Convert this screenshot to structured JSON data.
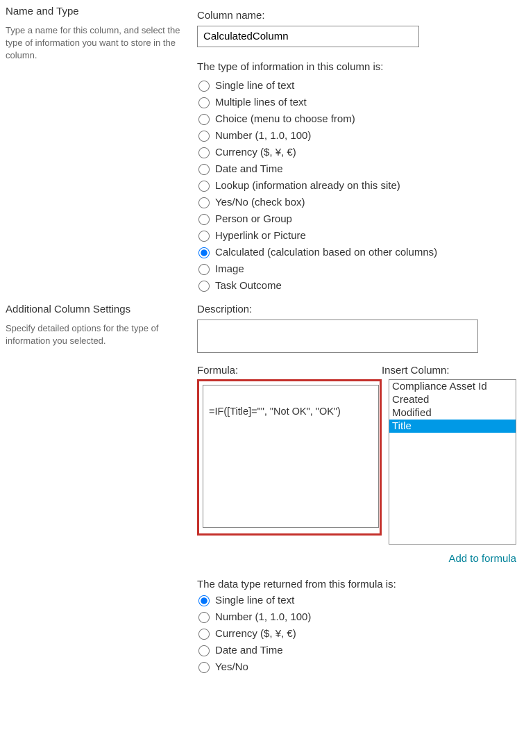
{
  "section1": {
    "title": "Name and Type",
    "desc": "Type a name for this column, and select the type of information you want to store in the column."
  },
  "columnName": {
    "label": "Column name:",
    "value": "CalculatedColumn"
  },
  "typeInfo": {
    "label": "The type of information in this column is:",
    "options": [
      {
        "label": "Single line of text",
        "checked": false
      },
      {
        "label": "Multiple lines of text",
        "checked": false
      },
      {
        "label": "Choice (menu to choose from)",
        "checked": false
      },
      {
        "label": "Number (1, 1.0, 100)",
        "checked": false
      },
      {
        "label": "Currency ($, ¥, €)",
        "checked": false
      },
      {
        "label": "Date and Time",
        "checked": false
      },
      {
        "label": "Lookup (information already on this site)",
        "checked": false
      },
      {
        "label": "Yes/No (check box)",
        "checked": false
      },
      {
        "label": "Person or Group",
        "checked": false
      },
      {
        "label": "Hyperlink or Picture",
        "checked": false
      },
      {
        "label": "Calculated (calculation based on other columns)",
        "checked": true
      },
      {
        "label": "Image",
        "checked": false
      },
      {
        "label": "Task Outcome",
        "checked": false
      }
    ]
  },
  "section2": {
    "title": "Additional Column Settings",
    "desc": "Specify detailed options for the type of information you selected."
  },
  "description": {
    "label": "Description:",
    "value": ""
  },
  "formula": {
    "label": "Formula:",
    "value": "=IF([Title]=\"\", \"Not OK\", \"OK\")"
  },
  "insertColumn": {
    "label": "Insert Column:",
    "items": [
      {
        "label": "Compliance Asset Id",
        "selected": false
      },
      {
        "label": "Created",
        "selected": false
      },
      {
        "label": "Modified",
        "selected": false
      },
      {
        "label": "Title",
        "selected": true
      }
    ],
    "addLink": "Add to formula"
  },
  "returnType": {
    "label": "The data type returned from this formula is:",
    "options": [
      {
        "label": "Single line of text",
        "checked": true
      },
      {
        "label": "Number (1, 1.0, 100)",
        "checked": false
      },
      {
        "label": "Currency ($, ¥, €)",
        "checked": false
      },
      {
        "label": "Date and Time",
        "checked": false
      },
      {
        "label": "Yes/No",
        "checked": false
      }
    ]
  }
}
